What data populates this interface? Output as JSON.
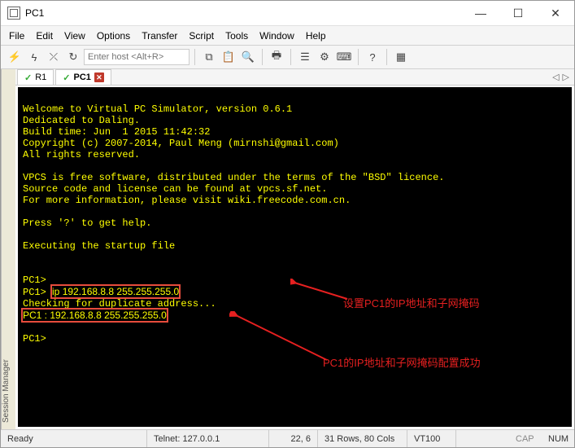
{
  "window": {
    "title": "PC1"
  },
  "menu": {
    "file": "File",
    "edit": "Edit",
    "view": "View",
    "options": "Options",
    "transfer": "Transfer",
    "script": "Script",
    "tools": "Tools",
    "window": "Window",
    "help": "Help"
  },
  "toolbar": {
    "host_placeholder": "Enter host <Alt+R>"
  },
  "sidebar": {
    "label": "Session Manager"
  },
  "tabs": {
    "items": [
      {
        "label": "R1",
        "active": false
      },
      {
        "label": "PC1",
        "active": true
      }
    ]
  },
  "terminal": {
    "lines": [
      "",
      "Welcome to Virtual PC Simulator, version 0.6.1",
      "Dedicated to Daling.",
      "Build time: Jun  1 2015 11:42:32",
      "Copyright (c) 2007-2014, Paul Meng (mirnshi@gmail.com)",
      "All rights reserved.",
      "",
      "VPCS is free software, distributed under the terms of the \"BSD\" licence.",
      "Source code and license can be found at vpcs.sf.net.",
      "For more information, please visit wiki.freecode.com.cn.",
      "",
      "Press '?' to get help.",
      "",
      "Executing the startup file",
      "",
      "",
      "PC1>"
    ],
    "cmd_prompt": "PC1> ",
    "cmd_text": "ip 192.168.8.8 255.255.255.0",
    "checking": "Checking for duplicate address...",
    "result": "PC1 : 192.168.8.8 255.255.255.0",
    "final_prompt": "PC1>"
  },
  "annotations": {
    "a1": "设置PC1的IP地址和子网掩码",
    "a2": "PC1的IP地址和子网掩码配置成功"
  },
  "status": {
    "ready": "Ready",
    "telnet": "Telnet: 127.0.0.1",
    "pos": "22,   6",
    "size": "31 Rows, 80 Cols",
    "term": "VT100",
    "caps": "CAP",
    "num": "NUM"
  }
}
